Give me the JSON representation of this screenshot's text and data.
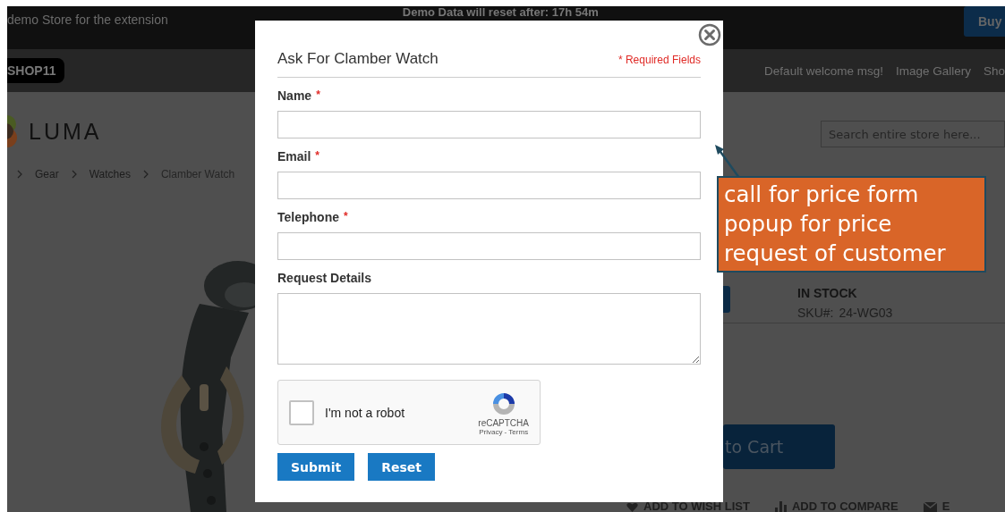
{
  "top_bar": {
    "notice": "demo Store for the extension",
    "countdown": "Demo Data will reset after: 17h 54m",
    "buy_button": "Buy"
  },
  "nav_bar": {
    "badge": "SHOP11",
    "links": [
      "Default welcome msg!",
      "Image Gallery",
      "Sho"
    ]
  },
  "header": {
    "logo": "LUMA",
    "search": {
      "placeholder": "Search entire store here..."
    }
  },
  "breadcrumbs": [
    "Gear",
    "Watches",
    "Clamber Watch"
  ],
  "product": {
    "picture": {
      "kind": "picture"
    },
    "stock": "IN STOCK",
    "sku_label": "SKU#:",
    "sku": "24-WG03",
    "cart_button": "to Cart",
    "actions": [
      "ADD TO WISH LIST",
      "ADD TO COMPARE",
      "E"
    ]
  },
  "modal": {
    "title": "Ask For Clamber Watch",
    "required_note": "* Required Fields",
    "fields": [
      {
        "label": "Name",
        "mark": "*",
        "kind": "input"
      },
      {
        "label": "Email",
        "mark": "*",
        "kind": "input"
      },
      {
        "label": "Telephone",
        "mark": "*",
        "kind": "input"
      },
      {
        "label": "Request Details",
        "kind": "textarea"
      }
    ],
    "captcha": {
      "label": "I'm not a robot",
      "checked": false,
      "brand": "reCAPTCHA",
      "links": "Privacy - Terms"
    },
    "buttons": [
      "Submit",
      "Reset"
    ]
  },
  "annotation": {
    "text": "call for price form popup for price request of customer"
  }
}
